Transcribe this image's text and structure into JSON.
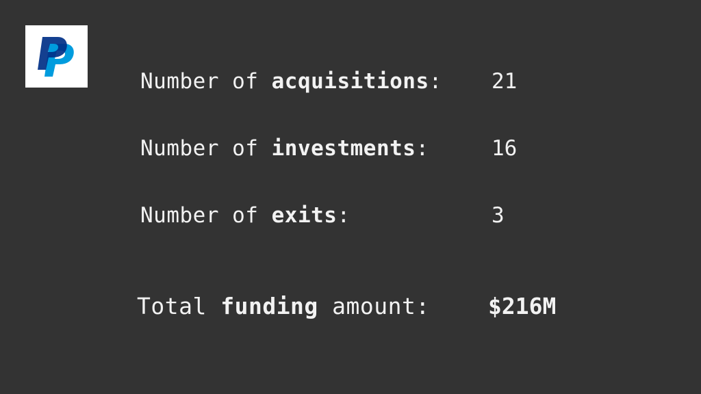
{
  "logo": {
    "icon": "paypal-logo-icon",
    "colors": {
      "dark": "#003087",
      "light": "#009cde",
      "background": "#ffffff"
    }
  },
  "stats": [
    {
      "prefix": "Number of ",
      "keyword": "acquisitions",
      "suffix": ":",
      "value": "21"
    },
    {
      "prefix": "Number of ",
      "keyword": "investments",
      "suffix": ":",
      "value": "16"
    },
    {
      "prefix": "Number of ",
      "keyword": "exits",
      "suffix": ":",
      "value": "3"
    }
  ],
  "total": {
    "prefix": "Total ",
    "keyword": "funding",
    "suffix": " amount:",
    "value": "$216M"
  },
  "colors": {
    "background": "#333333",
    "text": "#f2f2f2"
  }
}
